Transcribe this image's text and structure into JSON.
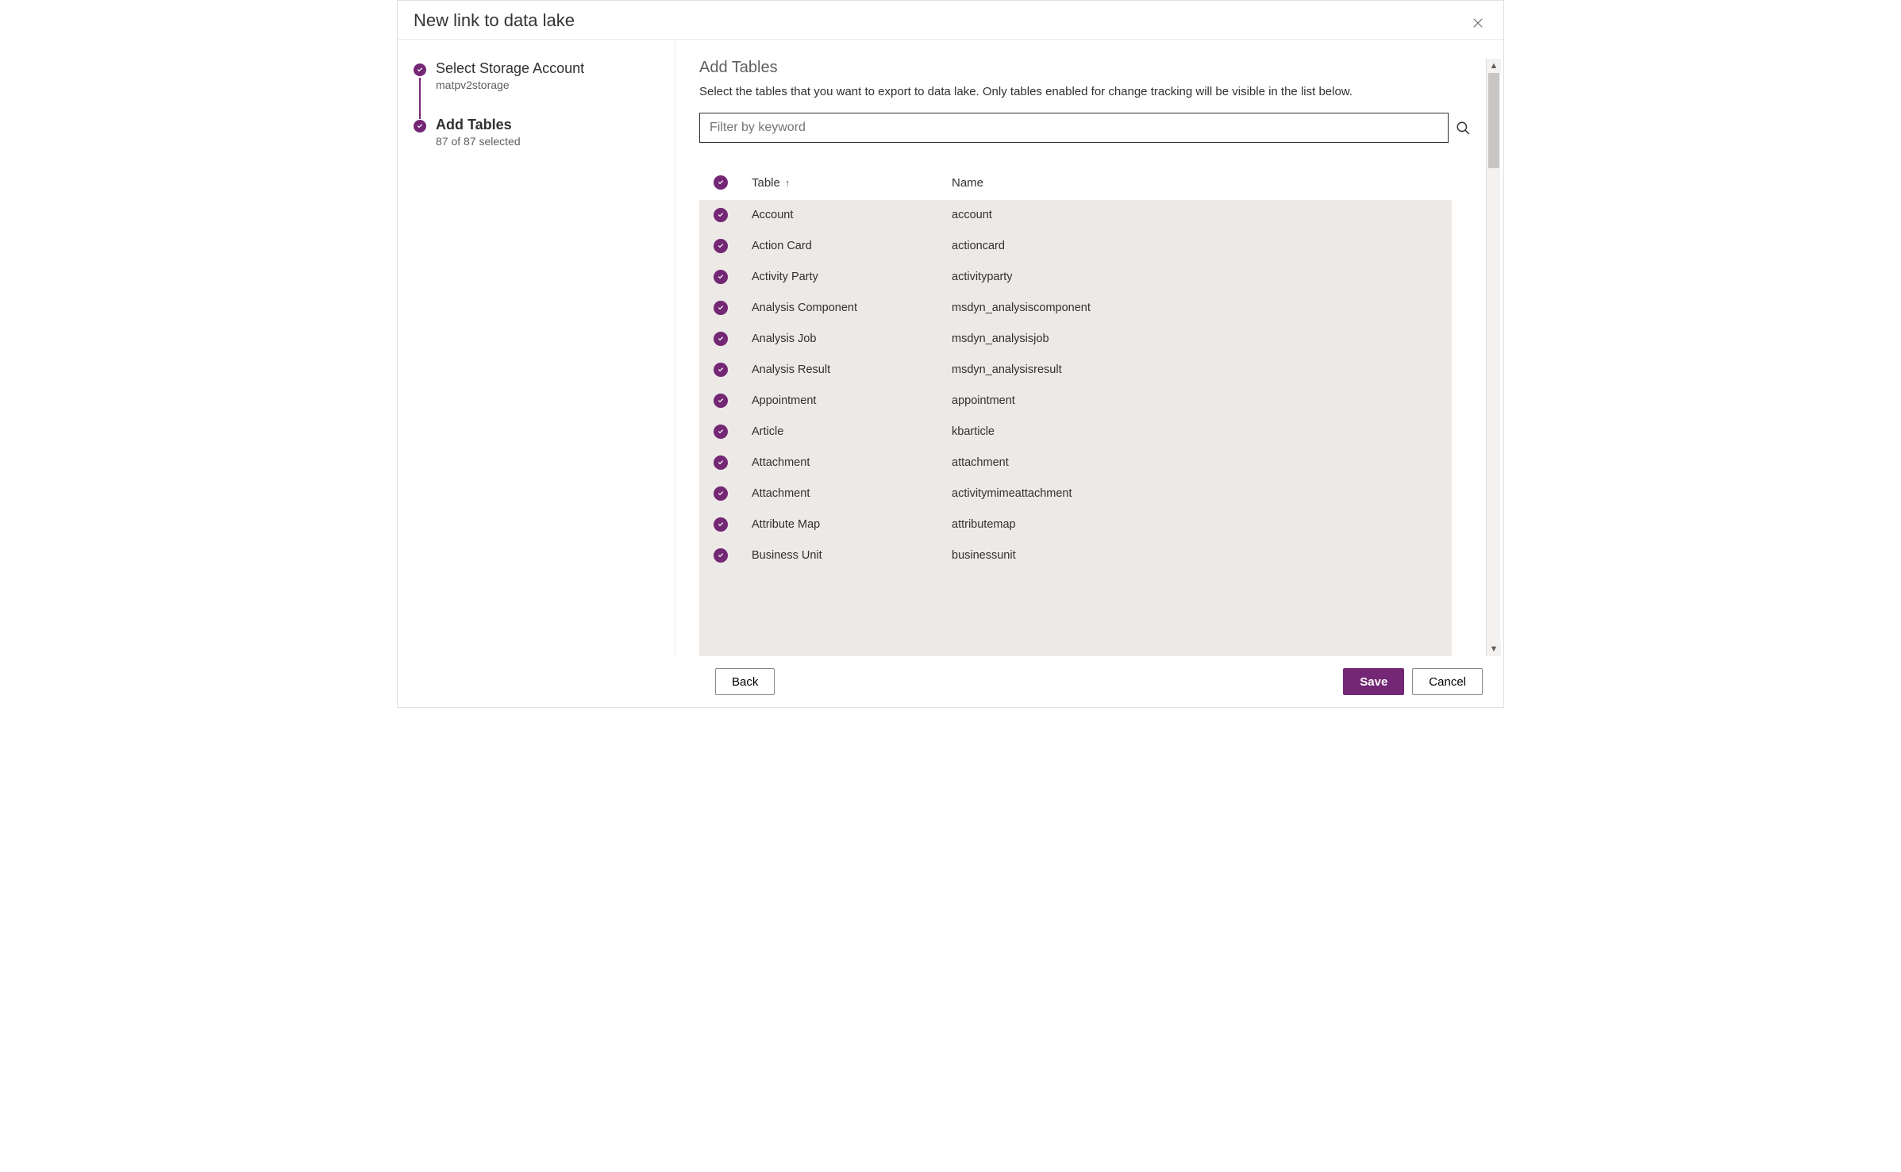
{
  "modal": {
    "title": "New link to data lake"
  },
  "sidebar": {
    "steps": [
      {
        "title": "Select Storage Account",
        "sub": "matpv2storage",
        "active": false
      },
      {
        "title": "Add Tables",
        "sub": "87 of 87 selected",
        "active": true
      }
    ]
  },
  "main": {
    "title": "Add Tables",
    "desc": "Select the tables that you want to export to data lake. Only tables enabled for change tracking will be visible in the list below.",
    "search_placeholder": "Filter by keyword"
  },
  "table": {
    "headers": {
      "table": "Table",
      "name": "Name"
    },
    "rows": [
      {
        "table": "Account",
        "name": "account"
      },
      {
        "table": "Action Card",
        "name": "actioncard"
      },
      {
        "table": "Activity Party",
        "name": "activityparty"
      },
      {
        "table": "Analysis Component",
        "name": "msdyn_analysiscomponent"
      },
      {
        "table": "Analysis Job",
        "name": "msdyn_analysisjob"
      },
      {
        "table": "Analysis Result",
        "name": "msdyn_analysisresult"
      },
      {
        "table": "Appointment",
        "name": "appointment"
      },
      {
        "table": "Article",
        "name": "kbarticle"
      },
      {
        "table": "Attachment",
        "name": "attachment"
      },
      {
        "table": "Attachment",
        "name": "activitymimeattachment"
      },
      {
        "table": "Attribute Map",
        "name": "attributemap"
      },
      {
        "table": "Business Unit",
        "name": "businessunit"
      }
    ]
  },
  "footer": {
    "back": "Back",
    "save": "Save",
    "cancel": "Cancel"
  }
}
